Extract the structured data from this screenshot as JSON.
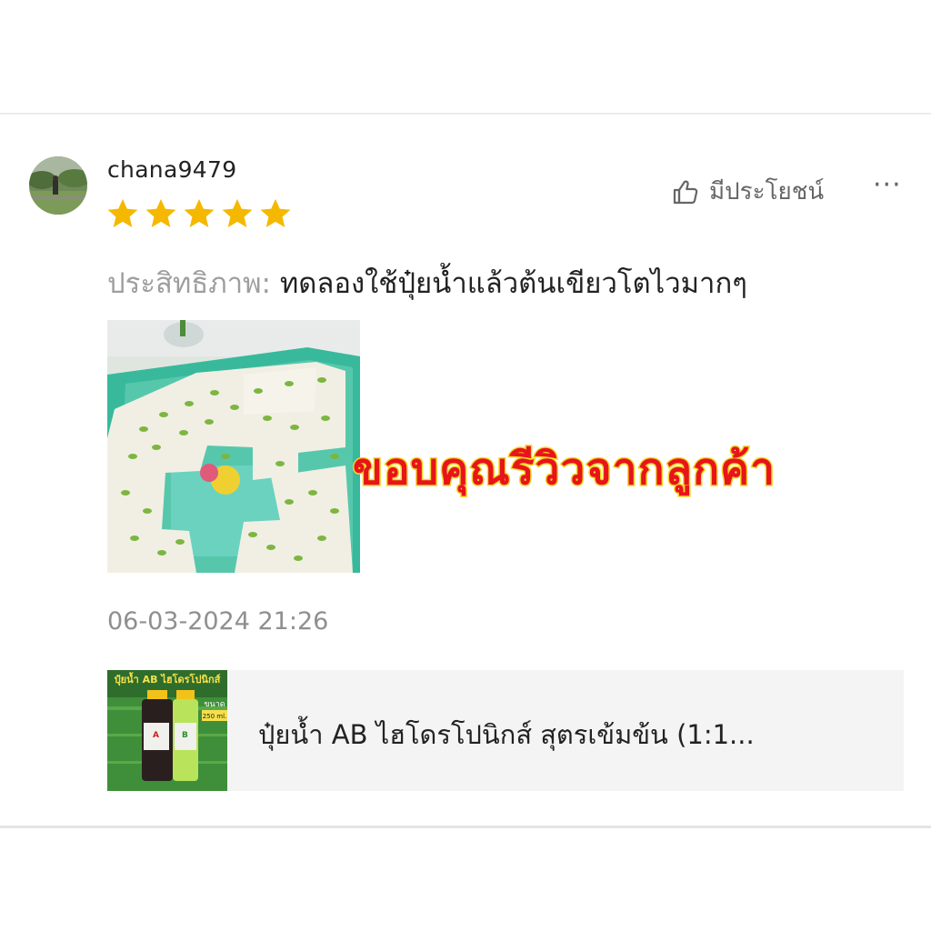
{
  "review": {
    "username": "chana9479",
    "rating": 5,
    "rating_max": 5,
    "helpful_label": "มีประโยชน์",
    "more_label": "···",
    "attribute_key": "ประสิทธิภาพ: ",
    "attribute_value": "ทดลองใช้ปุ๋ยน้ำแล้วต้นเขียวโตไวมากๆ",
    "overlay_text": "ขอบคุณรีวิวจากลูกค้า",
    "timestamp": "06-03-2024 21:26"
  },
  "product": {
    "name": "ปุ๋ยน้ำ AB ไฮโดรโปนิกส์  สุตรเข้มข้น (1:1...",
    "thumb_title": "ปุ๋ยน้ำ AB ไฮโดรโปนิกส์",
    "thumb_size_label": "ขนาด",
    "thumb_size": "250 ml."
  },
  "colors": {
    "star": "#f5b800",
    "overlay_fill": "#e8141a",
    "overlay_stroke": "#f3d72a",
    "muted_text": "#9e9e9e",
    "product_bg": "#f4f4f4"
  },
  "icons": {
    "helpful": "thumbs-up-icon",
    "more": "more-dots-icon",
    "star": "star-icon"
  }
}
